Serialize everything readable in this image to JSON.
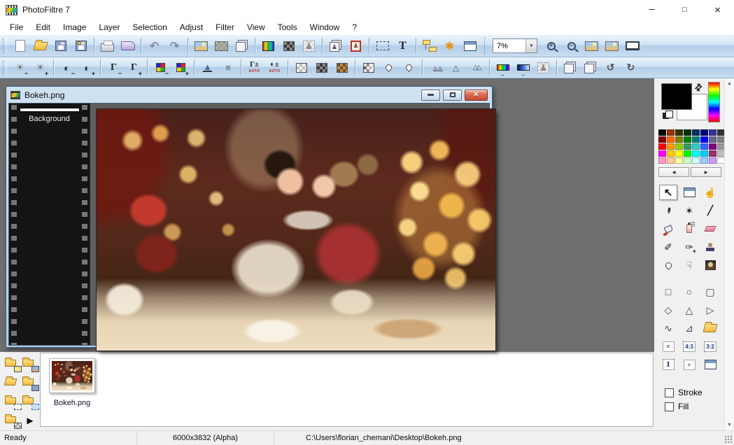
{
  "window": {
    "title": "PhotoFiltre 7",
    "controls": {
      "minimize": "–",
      "maximize": "□",
      "close": "×"
    }
  },
  "menu": [
    "File",
    "Edit",
    "Image",
    "Layer",
    "Selection",
    "Adjust",
    "Filter",
    "View",
    "Tools",
    "Window",
    "?"
  ],
  "toolbar": {
    "zoom_level": "7%",
    "dropdown_arrow": "▼"
  },
  "glyphs": {
    "undo": "↶",
    "redo": "↷",
    "text_tool": "T",
    "explode": "✱",
    "plus": "+",
    "minus": "−",
    "sun": "☀",
    "contrast": "◐",
    "gamma": "Γ",
    "plusminus": "±",
    "auto_word": "AUTO",
    "histogram": "▲",
    "levels": "≡",
    "mountains": "▲▲",
    "cone": "△",
    "cones": "△△",
    "figure": "♟",
    "width_arrow": "↔",
    "shift_arrow": "→",
    "rotate_left": "↺",
    "rotate_right": "↻",
    "pointer": "↖",
    "hand": "☝",
    "pipette": "✒",
    "wand": "✶",
    "line": "╱",
    "brush": "✐",
    "brush_plus": "✑",
    "smudge": "☟",
    "square": "□",
    "circle": "○",
    "rounded": "▢",
    "diamond": "◇",
    "triangle": "△",
    "rtriangle": "▷",
    "lasso": "∿",
    "polygon": "⊿",
    "coords": "=",
    "ratio_43": "4:3",
    "ratio_32": "3:2",
    "letter_i": "I",
    "manual_plus": "+",
    "swap": "⇄",
    "prev": "◀",
    "next": "▶",
    "scroll_up": "▲",
    "scroll_down": "▼",
    "play": "▶",
    "doc_close": "✕"
  },
  "doc_window": {
    "title": "Bokeh.png",
    "layer_name": "Background"
  },
  "right_panel": {
    "foreground_color": "#000000",
    "background_color": "#ffffff",
    "palette": [
      "#000000",
      "#993300",
      "#333300",
      "#003300",
      "#003366",
      "#000080",
      "#333399",
      "#333333",
      "#800000",
      "#ff6600",
      "#808000",
      "#008000",
      "#008080",
      "#0000ff",
      "#666699",
      "#808080",
      "#ff0000",
      "#ff9900",
      "#99cc00",
      "#339966",
      "#33cccc",
      "#3366ff",
      "#800080",
      "#999999",
      "#ff00ff",
      "#ffcc00",
      "#ffff00",
      "#00ff00",
      "#00ffff",
      "#00ccff",
      "#993366",
      "#c0c0c0",
      "#ff99cc",
      "#ffcc99",
      "#ffff99",
      "#ccffcc",
      "#ccffff",
      "#99ccff",
      "#cc99ff",
      "#ffffff"
    ],
    "stroke_label": "Stroke",
    "fill_label": "Fill"
  },
  "image_strip": {
    "file_label": "Bokeh.png"
  },
  "status_bar": {
    "ready": "Ready",
    "dimensions": "6000x3832 (Alpha)",
    "file_path": "C:\\Users\\florian_chemani\\Desktop\\Bokeh.png"
  },
  "accent_colors": {
    "toolbar_top": "#ecf4fb",
    "toolbar_bottom": "#b2cee9",
    "workspace_gray": "#6e6e6e",
    "doc_frame_blue": "#aecbe5",
    "close_button_red": "#c64a32"
  }
}
